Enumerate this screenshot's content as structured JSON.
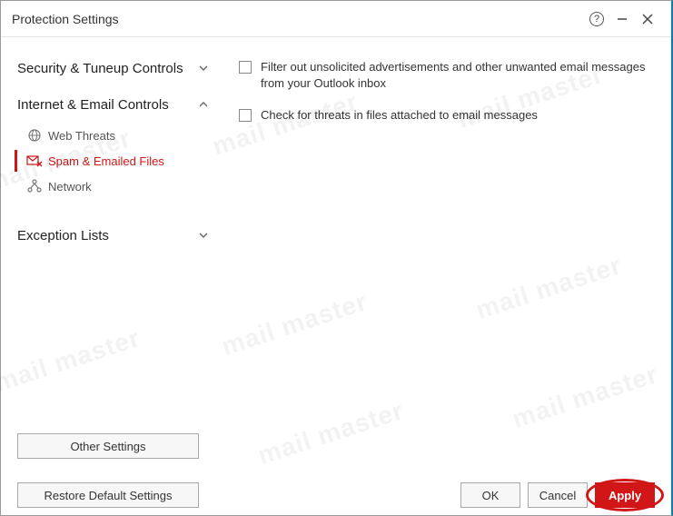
{
  "window": {
    "title": "Protection Settings"
  },
  "sidebar": {
    "sections": [
      {
        "label": "Security & Tuneup Controls",
        "expanded": false
      },
      {
        "label": "Internet & Email Controls",
        "expanded": true,
        "items": [
          {
            "label": "Web Threats",
            "icon": "globe-icon",
            "active": false
          },
          {
            "label": "Spam & Emailed Files",
            "icon": "mail-x-icon",
            "active": true
          },
          {
            "label": "Network",
            "icon": "network-icon",
            "active": false
          }
        ]
      },
      {
        "label": "Exception Lists",
        "expanded": false
      }
    ],
    "other_settings": "Other Settings",
    "restore_defaults": "Restore Default Settings"
  },
  "content": {
    "options": [
      {
        "label": "Filter out unsolicited advertisements and other unwanted email messages from your Outlook inbox",
        "checked": false
      },
      {
        "label": "Check for threats in files attached to email messages",
        "checked": false
      }
    ]
  },
  "footer": {
    "ok": "OK",
    "cancel": "Cancel",
    "apply": "Apply"
  },
  "watermark": "mail master"
}
